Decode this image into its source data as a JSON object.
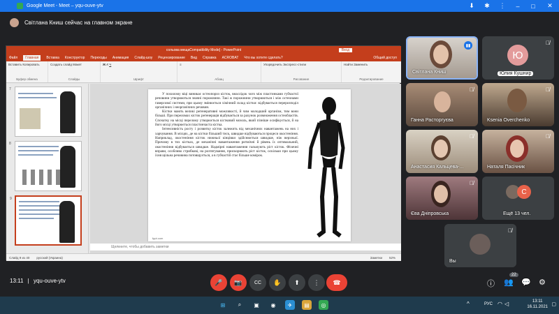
{
  "browser": {
    "tab_title": "Google Meet - Meet – yqu-ouve-ytv",
    "controls": {
      "minimize": "–",
      "maximize": "□",
      "close": "✕"
    }
  },
  "notice": {
    "text": "Світлана Книш сейчас на главном экране"
  },
  "powerpoint": {
    "title": "сольова мещаCompatibility Mode] - PowerPoint",
    "login": "Вход",
    "tabs": [
      "Файл",
      "Главная",
      "Вставка",
      "Конструктор",
      "Переходы",
      "Анимация",
      "Слайд-шоу",
      "Рецензирование",
      "Вид",
      "Справка",
      "ACROBAT",
      "Что вы хотите сделать?"
    ],
    "share": "Общий доступ",
    "ribbon_groups": [
      {
        "name": "Буфер обмена",
        "items": [
          "Вставить",
          "Копировать",
          "Формат"
        ]
      },
      {
        "name": "Слайды",
        "items": [
          "Создать слайд",
          "Макет",
          "Сбросить",
          "Раздел"
        ]
      },
      {
        "name": "Шрифт",
        "items": [
          "Ж",
          "К",
          "Ч",
          "S"
        ]
      },
      {
        "name": "Абзац",
        "items": [
          "≡",
          "≡",
          "≡"
        ]
      },
      {
        "name": "Рисование",
        "items": [
          "Упорядочить",
          "Экспресс-стили"
        ]
      },
      {
        "name": "Редактирование",
        "items": [
          "Найти",
          "Заменить",
          "Выделить"
        ]
      }
    ],
    "thumb_numbers": [
      "7",
      "8",
      "9"
    ],
    "slide_paragraphs": [
      "У похилому віці виникає остеопороз кісток, внаслідок чого між пластинками губчастої речовини утворюються значні порожнини. Такі ж порожнини утворюються і між остеонами гаверсової системи, при цьому змінюється хімічний склад кістки: відбувається перерозподіл органічних і неорганічних речовин.",
      "Кістки мають великі регенеративні можливості, й чим молодший організм, тим вони більші. При переломах кісток регенерація відбувається за рахунок розмноження остеобластів. Спочатку на місці перелому утворюється кістковий мозоль, який пізніше осифікується, й на його місці утворюється пластинчаста кістка.",
      "Інтенсивність росту і розвитку кісток залежить від механічних навантажень на них і харчування. В місцях, де на кістки більший тиск, швидше відбуваються процеси окостеніння. Наприклад, окостеніння кісток нижньої кінцівки здійснюється швидше, ніж верхньої. Причому в тих кістках, де механічні навантаження ритмічні й рівень їх оптимальний, окостеніння відбувається швидше. Надмірні навантаження гальмують ріст кісток. Фізичні вправи, особливо стрибкові, на розтягування, прискорюють ріст кісток, оскільки при цьому їхня щільна речовина потовщується, а в губчастій стає більше комірок."
    ],
    "slide_footer": "fppt.com",
    "notes_placeholder": "Щелкните, чтобы добавить заметки",
    "status": {
      "slide": "Слайд 9 из 40",
      "language": "русский (Украина)",
      "notes": "Заметки",
      "zoom": "52%"
    }
  },
  "participants": [
    {
      "name": "Світлана Книш",
      "mic": "speaking",
      "color": "#7b6a5e"
    },
    {
      "name": "Юлия Кушнир",
      "initial": "Ю",
      "avatar_color": "#e39b9b",
      "mic": "muted"
    },
    {
      "name": "Ганна Расторгуєва",
      "mic": "muted",
      "color": "#a88c76"
    },
    {
      "name": "Ksenia Overchenko",
      "mic": "muted",
      "color": "#8a7560"
    },
    {
      "name": "Анастасия Кальцева-...",
      "mic": "muted",
      "color": "#b3a18c"
    },
    {
      "name": "Наталя Пасічник",
      "mic": "muted",
      "color": "#6a5244"
    },
    {
      "name": "Єва Дніпровська",
      "mic": "muted",
      "color": "#7a5b5e"
    },
    {
      "name": "Ещё 13 чел.",
      "initial": "С",
      "avatar_color": "#e8624a",
      "mic": "none"
    },
    {
      "name": "Вы",
      "mic": "muted",
      "color": "#6b5e5a"
    }
  ],
  "meeting": {
    "time": "13:11",
    "separator": "|",
    "code": "yqu-ouve-ytv",
    "participant_count": "22"
  },
  "controls": {
    "mic": "🎤",
    "camera": "📷",
    "captions": "CC",
    "raise_hand": "✋",
    "present": "⬆",
    "more": "⋮",
    "hangup": "☎",
    "info": "ⓘ",
    "people": "👥",
    "chat": "💬",
    "activities": "⚙"
  },
  "taskbar": {
    "lang": "РУС",
    "time": "13:11",
    "date": "16.11.2021",
    "icons": [
      "⊞",
      "⌕",
      "▣",
      "◉",
      "✈",
      "▤",
      "◎"
    ]
  },
  "colors": {
    "chrome_blue": "#1a73e8",
    "meet_bg": "#202124",
    "ppt_red": "#c43e1c",
    "hangup_red": "#ea4335",
    "taskbar": "#1f3b4d"
  }
}
